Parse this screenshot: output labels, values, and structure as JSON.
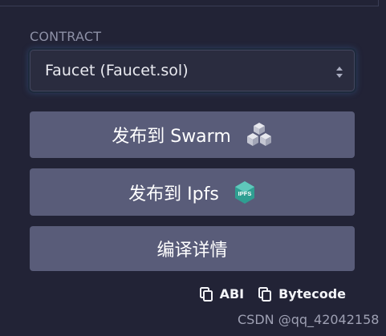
{
  "contract": {
    "label": "CONTRACT",
    "selected": "Faucet (Faucet.sol)"
  },
  "actions": {
    "publish_swarm": "发布到 Swarm",
    "publish_ipfs": "发布到 Ipfs",
    "compile_details": "编译详情"
  },
  "copy_links": {
    "abi": "ABI",
    "bytecode": "Bytecode"
  },
  "watermark": "CSDN @qq_42042158",
  "colors": {
    "background": "#222336",
    "button": "#595c79",
    "select_bg": "#2a2c3f",
    "ipfs_accent": "#2f9e91"
  },
  "icons": {
    "select": "updown-chevron-icon",
    "swarm": "swarm-logo-icon",
    "ipfs": "ipfs-logo-icon",
    "copy": "copy-icon"
  }
}
